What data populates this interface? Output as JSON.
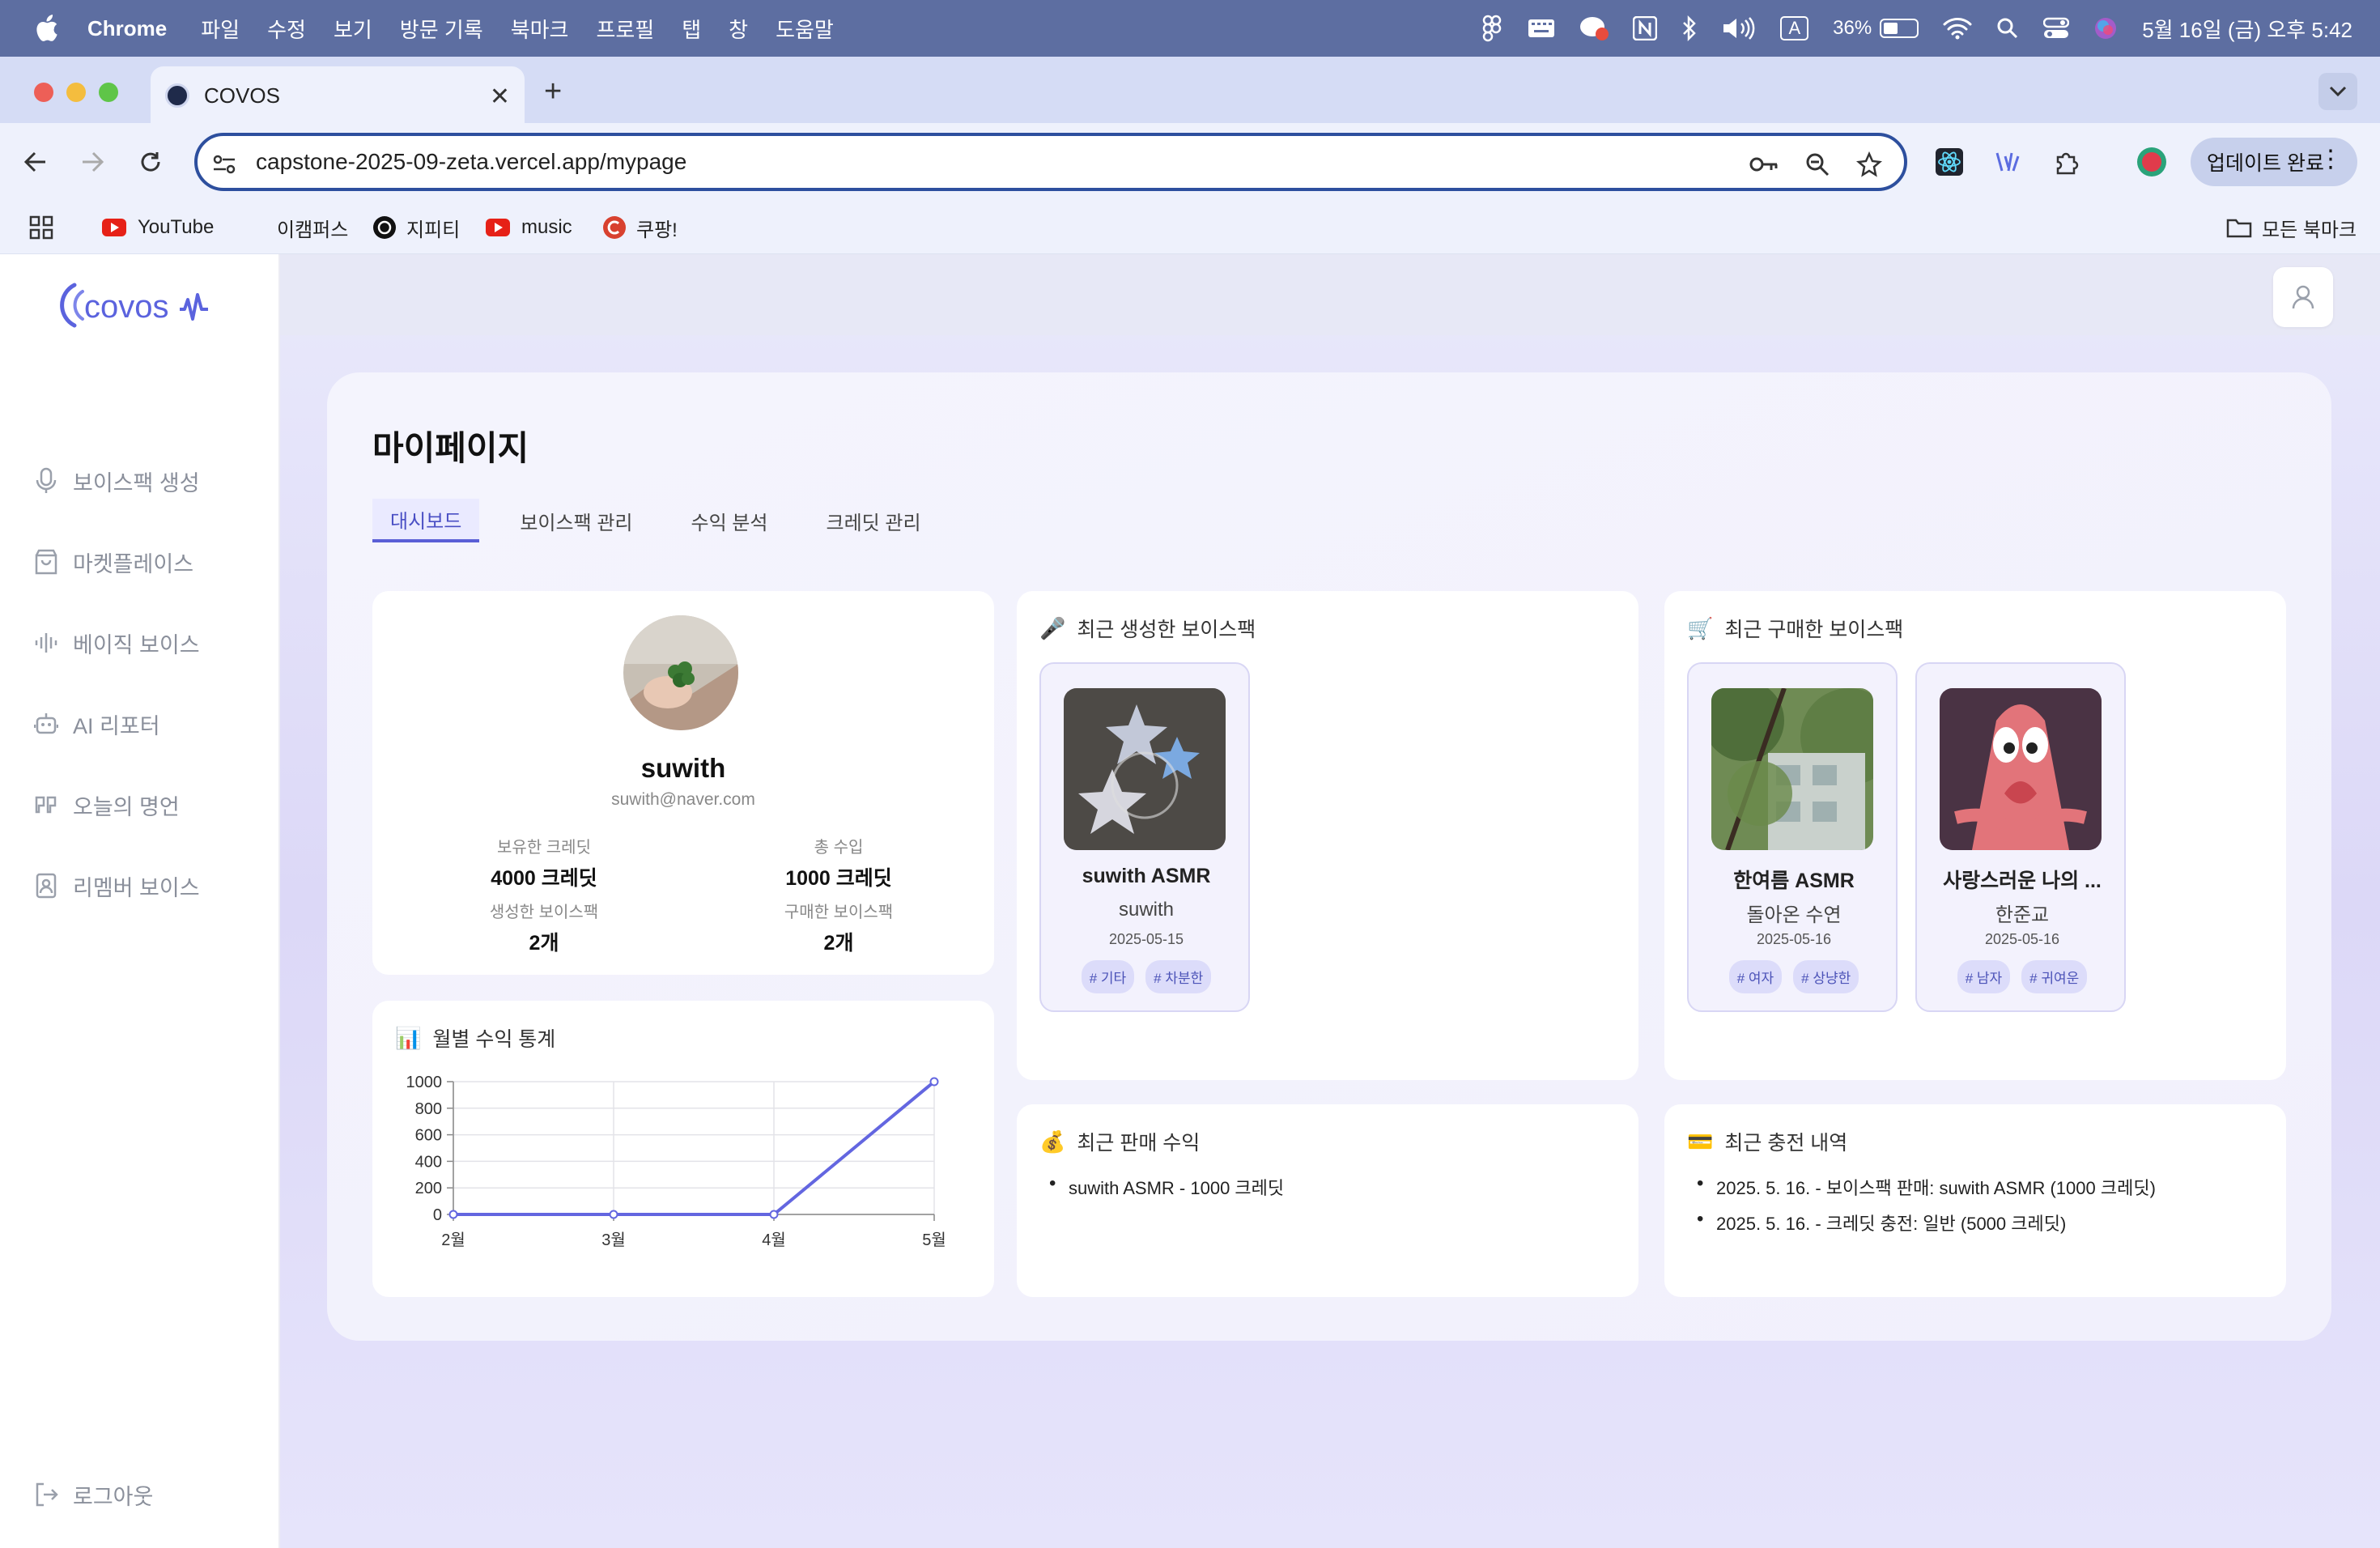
{
  "menubar": {
    "app": "Chrome",
    "items": [
      "파일",
      "수정",
      "보기",
      "방문 기록",
      "북마크",
      "프로필",
      "탭",
      "창",
      "도움말"
    ],
    "battery": "36%",
    "datetime": "5월 16일 (금) 오후 5:42",
    "input_indicator": "A"
  },
  "browser": {
    "tab_title": "COVOS",
    "url_host": "capstone-2025-09-zeta.vercel.app",
    "url_path": "/mypage",
    "update_label": "업데이트 완료",
    "bookmarks": [
      "YouTube",
      "이캠퍼스",
      "지피티",
      "music",
      "쿠팡!"
    ],
    "all_bookmarks": "모든 북마크"
  },
  "sidebar": {
    "logo": "covos",
    "items": [
      "보이스팩 생성",
      "마켓플레이스",
      "베이직 보이스",
      "AI 리포터",
      "오늘의 명언",
      "리멤버 보이스"
    ],
    "logout": "로그아웃"
  },
  "page": {
    "title": "마이페이지",
    "tabs": [
      "대시보드",
      "보이스팩 관리",
      "수익 분석",
      "크레딧 관리"
    ],
    "active_tab": "대시보드"
  },
  "profile": {
    "name": "suwith",
    "email": "suwith@naver.com",
    "credits_label": "보유한 크레딧",
    "credits": "4000 크레딧",
    "income_label": "총 수입",
    "income": "1000 크레딧",
    "created_label": "생성한 보이스팩",
    "created": "2개",
    "bought_label": "구매한 보이스팩",
    "bought": "2개"
  },
  "recent_created": {
    "title": "최근 생성한 보이스팩",
    "items": [
      {
        "title": "suwith ASMR",
        "author": "suwith",
        "date": "2025-05-15",
        "tags": [
          "# 기타",
          "# 차분한"
        ]
      }
    ]
  },
  "recent_bought": {
    "title": "최근 구매한 보이스팩",
    "items": [
      {
        "title": "한여름 ASMR",
        "author": "돌아온 수연",
        "date": "2025-05-16",
        "tags": [
          "# 여자",
          "# 상냥한"
        ]
      },
      {
        "title": "사랑스러운 나의 ...",
        "author": "한준교",
        "date": "2025-05-16",
        "tags": [
          "# 남자",
          "# 귀여운"
        ]
      }
    ]
  },
  "sales": {
    "title": "최근 판매 수익",
    "items": [
      "suwith ASMR - 1000 크레딧"
    ]
  },
  "charges": {
    "title": "최근 충전 내역",
    "items": [
      "2025. 5. 16. - 보이스팩 판매: suwith ASMR (1000 크레딧)",
      "2025. 5. 16. - 크레딧 충전: 일반 (5000 크레딧)"
    ]
  },
  "chart_data": {
    "type": "line",
    "title": "월별 수익 통계",
    "categories": [
      "2월",
      "3월",
      "4월",
      "5월"
    ],
    "series": [
      {
        "values": [
          0,
          0,
          0,
          1000
        ]
      }
    ],
    "yticks": [
      0,
      200,
      400,
      600,
      800,
      1000
    ],
    "ylim": [
      0,
      1000
    ],
    "grid": true,
    "color": "#6366e0"
  }
}
